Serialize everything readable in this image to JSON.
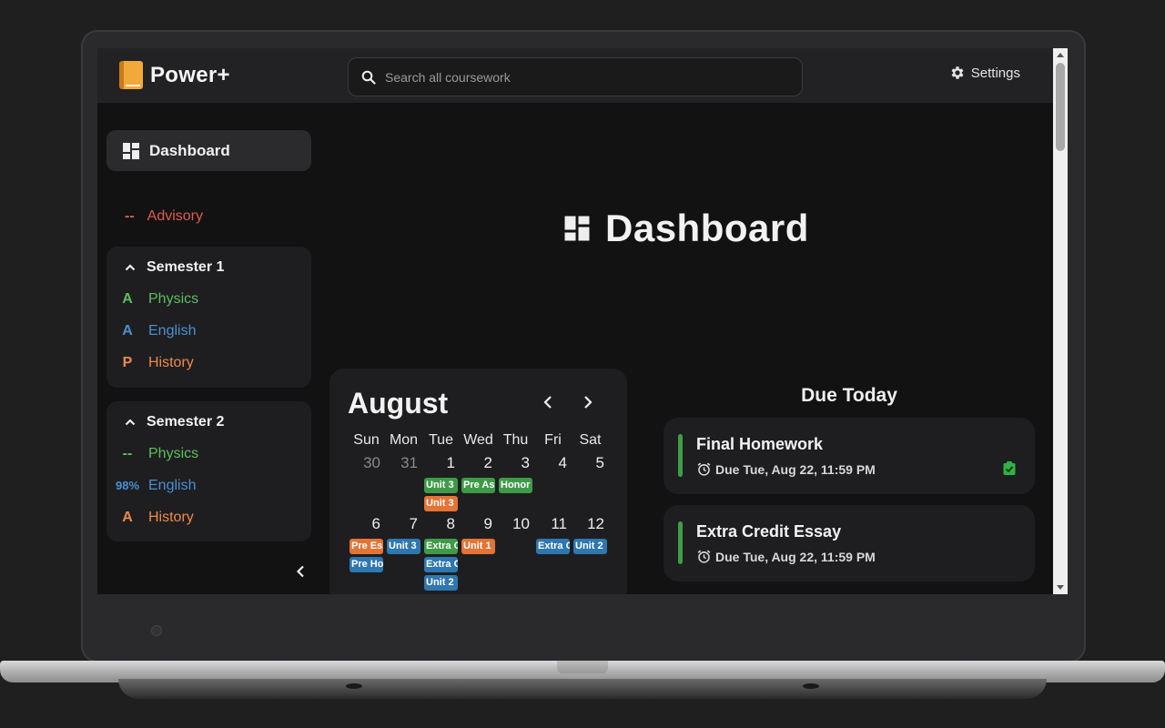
{
  "app": {
    "name": "Power+",
    "logo_icon": "book-icon"
  },
  "search": {
    "placeholder": "Search all coursework",
    "value": ""
  },
  "settings": {
    "label": "Settings"
  },
  "sidebar": {
    "dashboard_label": "Dashboard",
    "advisory": {
      "grade": "--",
      "label": "Advisory",
      "color": "#e05a50"
    },
    "semesters": [
      {
        "title": "Semester 1",
        "courses": [
          {
            "grade": "A",
            "name": "Physics",
            "color": "#5cbf5c"
          },
          {
            "grade": "A",
            "name": "English",
            "color": "#4a8fd1"
          },
          {
            "grade": "P",
            "name": "History",
            "color": "#ef8a4a"
          }
        ]
      },
      {
        "title": "Semester 2",
        "courses": [
          {
            "grade": "--",
            "name": "Physics",
            "color": "#5cbf5c"
          },
          {
            "grade": "98%",
            "name": "English",
            "color": "#4a8fd1"
          },
          {
            "grade": "A",
            "name": "History",
            "color": "#ef8a4a"
          }
        ]
      }
    ]
  },
  "main": {
    "title": "Dashboard"
  },
  "calendar": {
    "month": "August",
    "weekdays": [
      "Sun",
      "Mon",
      "Tue",
      "Wed",
      "Thu",
      "Fri",
      "Sat"
    ],
    "weeks": [
      [
        {
          "day": "30",
          "dim": true,
          "events": []
        },
        {
          "day": "31",
          "dim": true,
          "events": []
        },
        {
          "day": "1",
          "events": [
            {
              "label": "Unit 3",
              "color": "green"
            },
            {
              "label": "Unit 3",
              "color": "orange"
            }
          ]
        },
        {
          "day": "2",
          "events": [
            {
              "label": "Pre As",
              "color": "green"
            }
          ]
        },
        {
          "day": "3",
          "events": [
            {
              "label": "Honor",
              "color": "green"
            }
          ]
        },
        {
          "day": "4",
          "events": []
        },
        {
          "day": "5",
          "events": []
        }
      ],
      [
        {
          "day": "6",
          "events": [
            {
              "label": "Pre Es",
              "color": "orange"
            },
            {
              "label": "Pre Ho",
              "color": "blue"
            }
          ]
        },
        {
          "day": "7",
          "events": [
            {
              "label": "Unit 3",
              "color": "blue"
            }
          ]
        },
        {
          "day": "8",
          "events": [
            {
              "label": "Extra C",
              "color": "green"
            },
            {
              "label": "Extra C",
              "color": "blue"
            },
            {
              "label": "Unit 2",
              "color": "blue"
            }
          ]
        },
        {
          "day": "9",
          "events": [
            {
              "label": "Unit 1",
              "color": "orange"
            }
          ]
        },
        {
          "day": "10",
          "events": []
        },
        {
          "day": "11",
          "events": [
            {
              "label": "Extra C",
              "color": "blue"
            }
          ]
        },
        {
          "day": "12",
          "events": [
            {
              "label": "Unit 2",
              "color": "blue"
            }
          ]
        }
      ]
    ]
  },
  "due_today": {
    "title": "Due Today",
    "tasks": [
      {
        "name": "Final Homework",
        "due": "Due Tue, Aug 22, 11:59 PM",
        "submitted": true
      },
      {
        "name": "Extra Credit Essay",
        "due": "Due Tue, Aug 22, 11:59 PM",
        "submitted": false
      }
    ]
  }
}
